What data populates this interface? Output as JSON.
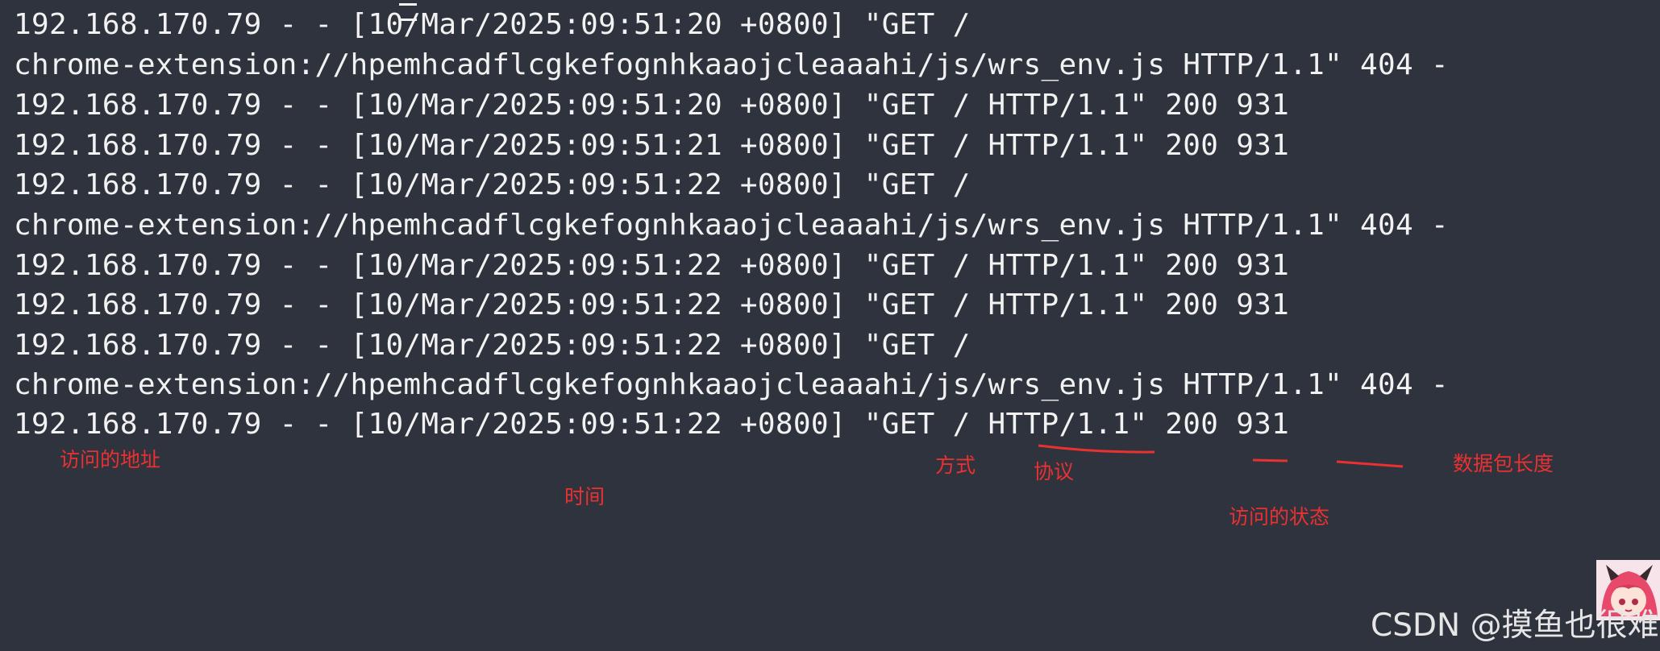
{
  "terminal": {
    "lines": [
      "192.168.170.79 - - [10/Mar/2025:09:51:20 +0800] \"GET /",
      "chrome-extension://hpemhcadflcgkefognhkaaojcleaaahi/js/wrs_env.js HTTP/1.1\" 404 -",
      "192.168.170.79 - - [10/Mar/2025:09:51:20 +0800] \"GET / HTTP/1.1\" 200 931",
      "192.168.170.79 - - [10/Mar/2025:09:51:21 +0800] \"GET / HTTP/1.1\" 200 931",
      "192.168.170.79 - - [10/Mar/2025:09:51:22 +0800] \"GET /",
      "chrome-extension://hpemhcadflcgkefognhkaaojcleaaahi/js/wrs_env.js HTTP/1.1\" 404 -",
      "192.168.170.79 - - [10/Mar/2025:09:51:22 +0800] \"GET / HTTP/1.1\" 200 931",
      "192.168.170.79 - - [10/Mar/2025:09:51:22 +0800] \"GET / HTTP/1.1\" 200 931",
      "192.168.170.79 - - [10/Mar/2025:09:51:22 +0800] \"GET /",
      "chrome-extension://hpemhcadflcgkefognhkaaojcleaaahi/js/wrs_env.js HTTP/1.1\" 404 -",
      "192.168.170.79 - - [10/Mar/2025:09:51:22 +0800] \"GET / HTTP/1.1\" 200 931"
    ]
  },
  "annotations": {
    "address": "访问的地址",
    "time": "时间",
    "method": "方式",
    "protocol": "协议",
    "status": "访问的状态",
    "length": "数据包长度"
  },
  "watermark": {
    "text": "CSDN @摸鱼也很难"
  },
  "colors": {
    "background": "#2e333d",
    "text": "#f2f2f2",
    "annotation": "#ea3131"
  }
}
